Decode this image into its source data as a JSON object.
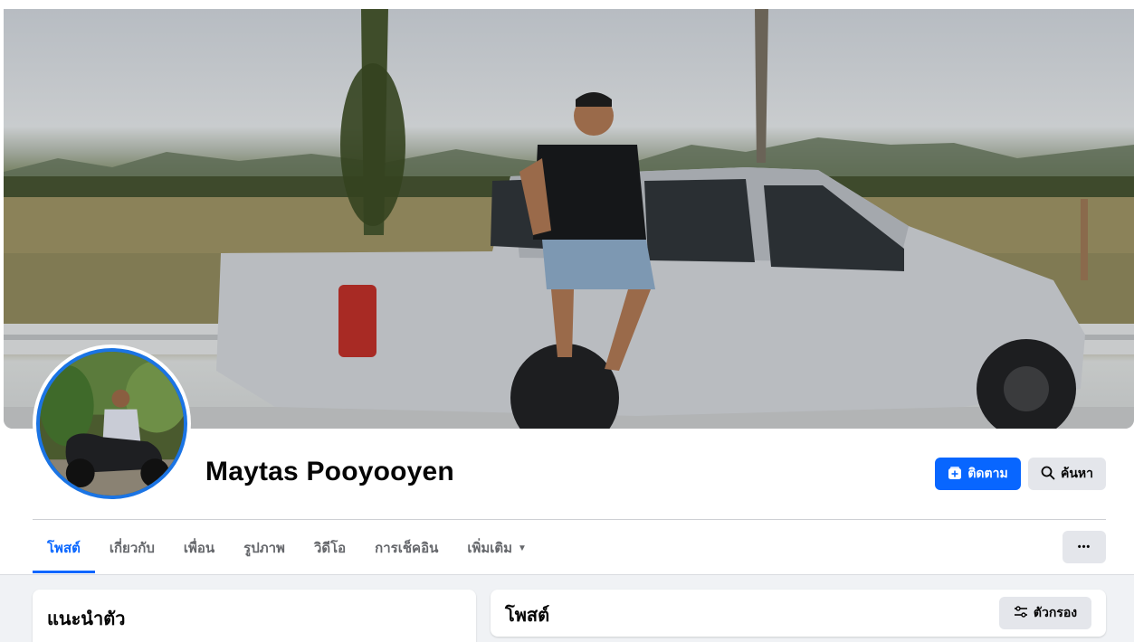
{
  "profile": {
    "name": "Maytas Pooyooyen"
  },
  "actions": {
    "follow_label": "ติดตาม",
    "search_label": "ค้นหา",
    "more_label": "•••"
  },
  "tabs": [
    {
      "label": "โพสต์",
      "active": true
    },
    {
      "label": "เกี่ยวกับ",
      "active": false
    },
    {
      "label": "เพื่อน",
      "active": false
    },
    {
      "label": "รูปภาพ",
      "active": false
    },
    {
      "label": "วิดีโอ",
      "active": false
    },
    {
      "label": "การเช็คอิน",
      "active": false
    },
    {
      "label": "เพิ่มเติม",
      "active": false,
      "caret": "▼"
    }
  ],
  "intro": {
    "title": "แนะนำตัว"
  },
  "posts": {
    "title": "โพสต์",
    "filter_label": "ตัวกรอง"
  },
  "icons": {
    "follow": "add-friend-icon",
    "search": "search-icon",
    "filter": "filter-icon",
    "more": "more-dots-icon"
  },
  "colors": {
    "accent": "#0866ff",
    "button_gray": "#e4e6eb",
    "page_bg": "#f0f2f5",
    "avatar_ring": "#1b74e4"
  }
}
